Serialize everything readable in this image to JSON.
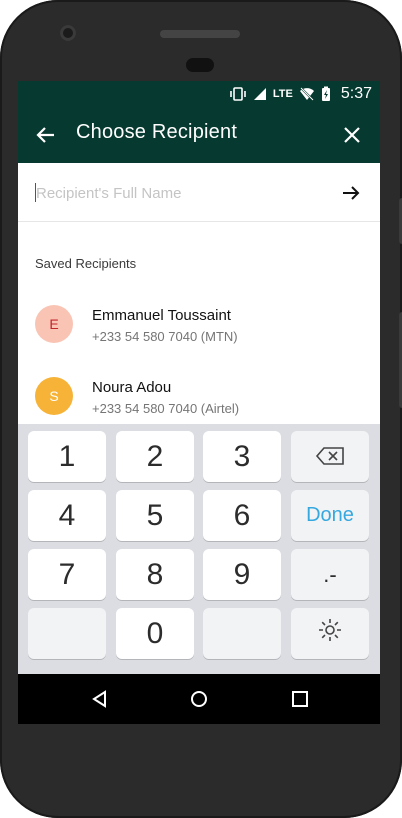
{
  "status_bar": {
    "time": "5:37",
    "network": "LTE"
  },
  "app_bar": {
    "title": "Choose Recipient"
  },
  "search": {
    "placeholder": "Recipient's Full Name",
    "value": ""
  },
  "saved": {
    "heading": "Saved Recipients",
    "recipients": [
      {
        "initial": "E",
        "name": "Emmanuel Toussaint",
        "phone": "+233 54 580 7040 (MTN)",
        "avatar_bg": "#f9c4b4",
        "avatar_fg": "#c1262b"
      },
      {
        "initial": "S",
        "name": "Noura Adou",
        "phone": "+233 54 580 7040 (Airtel)",
        "avatar_bg": "#f6b338",
        "avatar_fg": "#ffffff"
      }
    ]
  },
  "keyboard": {
    "keys": [
      "1",
      "2",
      "3",
      "4",
      "5",
      "6",
      "7",
      "8",
      "9",
      "0"
    ],
    "done_label": "Done",
    "symbol_label": ".-"
  },
  "colors": {
    "brand": "#06392f",
    "done": "#36a8e0"
  }
}
